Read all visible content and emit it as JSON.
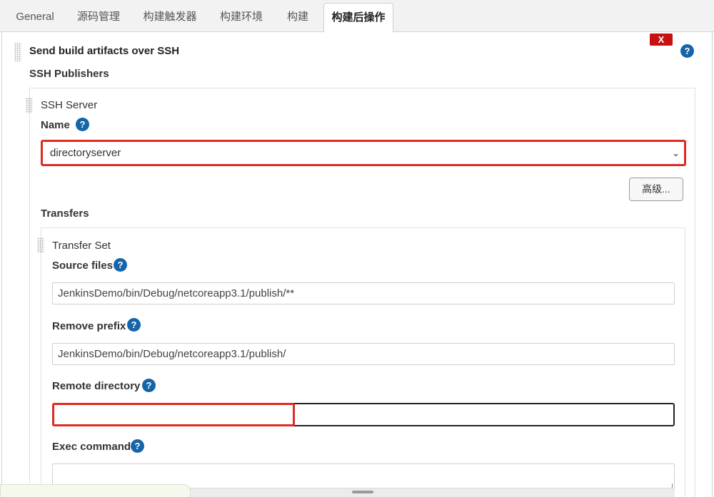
{
  "tabs": [
    {
      "label": "General"
    },
    {
      "label": "源码管理"
    },
    {
      "label": "构建触发器"
    },
    {
      "label": "构建环境"
    },
    {
      "label": "构建"
    },
    {
      "label": "构建后操作"
    }
  ],
  "section": {
    "title": "Send build artifacts over SSH",
    "delete_label": "X",
    "help_glyph": "?"
  },
  "publishers": {
    "label": "SSH Publishers"
  },
  "server": {
    "block_label": "SSH Server",
    "name_label": "Name",
    "name_value": "directoryserver",
    "advanced_label": "高级..."
  },
  "transfers": {
    "label": "Transfers",
    "set_label": "Transfer Set",
    "source_files_label": "Source files",
    "source_files_value": "JenkinsDemo/bin/Debug/netcoreapp3.1/publish/**",
    "remove_prefix_label": "Remove prefix",
    "remove_prefix_value": "JenkinsDemo/bin/Debug/netcoreapp3.1/publish/",
    "remote_directory_label": "Remote directory",
    "remote_directory_value": "",
    "exec_command_label": "Exec command",
    "exec_command_value": ""
  },
  "colors": {
    "help_blue": "#1565a8",
    "delete_red": "#c81010",
    "highlight_red": "#e02a22"
  },
  "icons": {
    "help": "help-icon",
    "delete": "delete-icon",
    "dropdown": "chevron-down-icon",
    "drag": "drag-handle-icon"
  }
}
